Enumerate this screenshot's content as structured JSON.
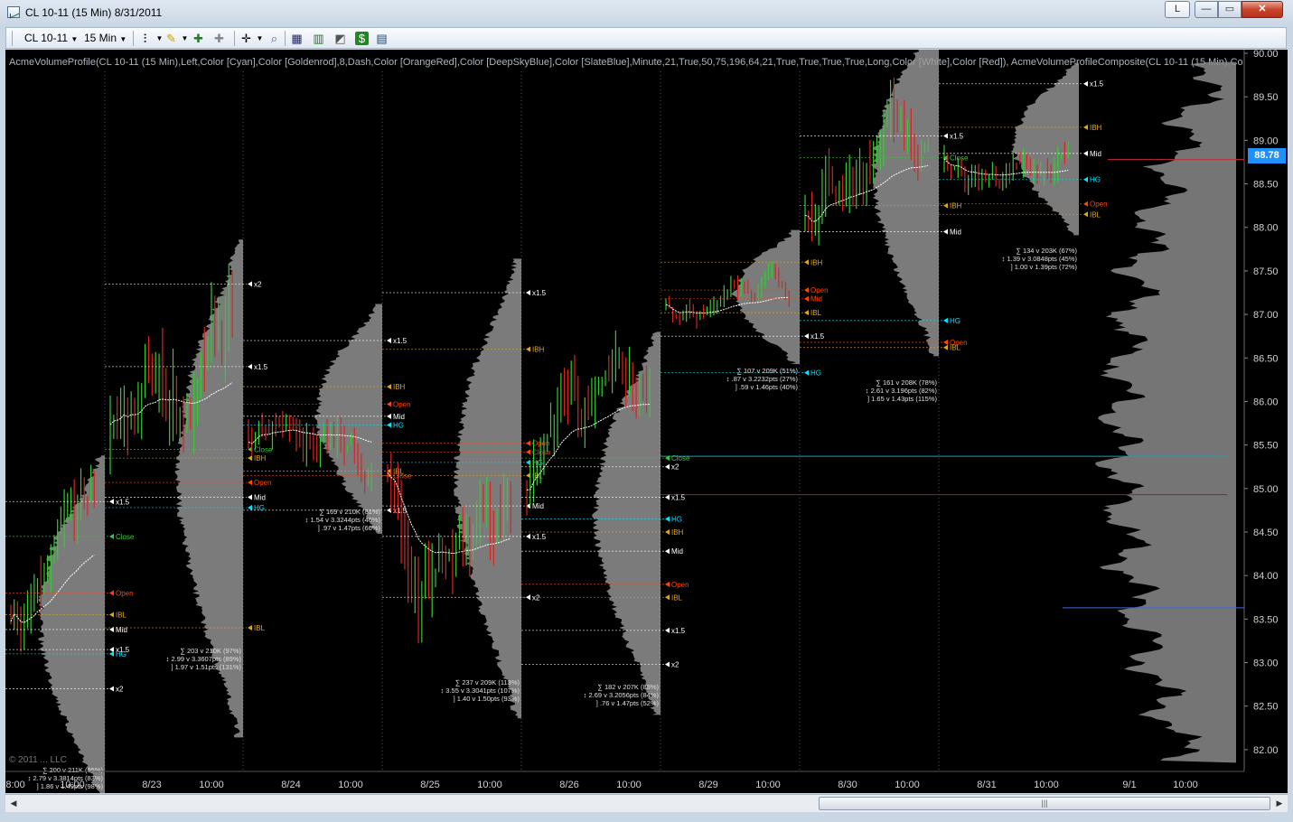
{
  "window": {
    "title": "CL 10-11 (15 Min)  8/31/2011",
    "btn_l": "L",
    "btn_min": "—",
    "btn_max": "▭",
    "btn_close": "✕"
  },
  "toolbar": {
    "instrument": "CL 10-11",
    "interval": "15 Min"
  },
  "indicator_label": "AcmeVolumeProfile(CL 10-11 (15 Min),Left,Color [Cyan],Color [Goldenrod],8,Dash,Color [OrangeRed],Color [DeepSkyBlue],Color [SlateBlue],Minute,21,True,50,75,196,64,21,True,True,True,True,Long,Color [White],Color [Red]), AcmeVolumeProfileComposite(CL 10-11 (15 Min),Co",
  "copyright": "© 2011 ... LLC",
  "current_price": "88.78",
  "colors": {
    "bg": "#000000",
    "up": "#33cc33",
    "down": "#dd2222",
    "cyan": "#00e5ff",
    "gold": "#daa520",
    "orange": "#ff4500",
    "white": "#ffffff"
  },
  "chart_data": {
    "type": "candlestick-volume-profile",
    "y_range": [
      81.75,
      90.0
    ],
    "y_ticks": [
      "90.00",
      "89.50",
      "89.00",
      "88.50",
      "88.00",
      "87.50",
      "87.00",
      "86.50",
      "86.00",
      "85.50",
      "85.00",
      "84.50",
      "84.00",
      "83.50",
      "83.00",
      "82.50",
      "82.00"
    ],
    "x_labels": [
      "08:00",
      "10:00",
      "8/23",
      "10:00",
      "8/24",
      "10:00",
      "8/25",
      "10:00",
      "8/26",
      "10:00",
      "8/29",
      "10:00",
      "8/30",
      "10:00",
      "8/31",
      "10:00",
      "9/1",
      "10:00"
    ],
    "sessions": [
      {
        "stats": [
          "∑ 200 v 211K (95%)",
          "↕ 2.79 v 3.3814pts (83%)",
          "] 1.86 v 1.49pts (98%)"
        ],
        "levels": [
          [
            "x1.5",
            84.85,
            "white"
          ],
          [
            "Close",
            84.45,
            "green"
          ],
          [
            "Open",
            83.8,
            "orange"
          ],
          [
            "IBL",
            83.55,
            "gold"
          ],
          [
            "Mid",
            83.38,
            "white"
          ],
          [
            "x1.5",
            83.15,
            "white"
          ],
          [
            "HG",
            83.1,
            "cyan"
          ],
          [
            "x2",
            82.7,
            "white"
          ]
        ]
      },
      {
        "stats": [
          "∑ 203 v 210K (97%)",
          "↕ 2.99 v 3.3607pts (89%)",
          "] 1.97 v 1.51pts (131%)"
        ],
        "levels": [
          [
            "x2",
            87.35,
            "white"
          ],
          [
            "x1.5",
            86.4,
            "white"
          ],
          [
            "Close",
            85.45,
            "green"
          ],
          [
            "IBH",
            85.35,
            "gold"
          ],
          [
            "Open",
            85.07,
            "orange"
          ],
          [
            "Mid",
            84.9,
            "white"
          ],
          [
            "HG",
            84.78,
            "cyan"
          ],
          [
            "IBL",
            83.4,
            "gold"
          ]
        ]
      },
      {
        "stats": [
          "∑ 169 v 210K (81%)",
          "↕ 1.54 v 3.3244pts (46%)",
          "] .97 v 1.47pts (66%)"
        ],
        "levels": [
          [
            "x1.5",
            86.7,
            "white"
          ],
          [
            "IBH",
            86.17,
            "gold"
          ],
          [
            "Open",
            85.97,
            "orange"
          ],
          [
            "Mid",
            85.83,
            "white"
          ],
          [
            "HG",
            85.73,
            "cyan"
          ],
          [
            "IBL",
            85.2,
            "gold"
          ],
          [
            "Close",
            85.15,
            "orange"
          ],
          [
            "x1.5",
            84.75,
            "white"
          ]
        ]
      },
      {
        "stats": [
          "∑ 237 v 209K (113%)",
          "↕ 3.55 v 3.3041pts (107%)",
          "] 1.40 v 1.50pts (93%)"
        ],
        "levels": [
          [
            "x1.5",
            87.25,
            "white"
          ],
          [
            "IBH",
            86.6,
            "gold"
          ],
          [
            "Open",
            85.52,
            "orange"
          ],
          [
            "Close",
            85.42,
            "orange"
          ],
          [
            "HG",
            85.3,
            "cyan"
          ],
          [
            "IBL",
            85.15,
            "gold"
          ],
          [
            "Mid",
            84.8,
            "white"
          ],
          [
            "x1.5",
            84.45,
            "white"
          ],
          [
            "x2",
            83.75,
            "white"
          ]
        ]
      },
      {
        "stats": [
          "∑ 182 v 207K (88%)",
          "↕ 2.69 v 3.2056pts (84%)",
          "] .76 v 1.47pts (52%)"
        ],
        "levels": [
          [
            "Close",
            85.35,
            "green"
          ],
          [
            "x2",
            85.25,
            "white"
          ],
          [
            "x1.5",
            84.9,
            "white"
          ],
          [
            "HG",
            84.65,
            "cyan"
          ],
          [
            "IBH",
            84.5,
            "gold"
          ],
          [
            "Mid",
            84.28,
            "white"
          ],
          [
            "Open",
            83.9,
            "orange"
          ],
          [
            "IBL",
            83.75,
            "gold"
          ],
          [
            "x1.5",
            83.37,
            "white"
          ],
          [
            "x2",
            82.98,
            "white"
          ]
        ]
      },
      {
        "stats": [
          "∑ 107 v 209K (51%)",
          "↕ .87 v 3.2232pts (27%)",
          "] .59 v 1.46pts (40%)"
        ],
        "levels": [
          [
            "IBH",
            87.6,
            "gold"
          ],
          [
            "Open",
            87.28,
            "orange"
          ],
          [
            "Mid",
            87.18,
            "orange"
          ],
          [
            "IBL",
            87.02,
            "gold"
          ],
          [
            "x1.5",
            86.75,
            "white"
          ],
          [
            "HG",
            86.33,
            "cyan"
          ]
        ]
      },
      {
        "stats": [
          "∑ 161 v 208K (78%)",
          "↕ 2.61 v 3.196pts (82%)",
          "] 1.65 v 1.43pts (115%)"
        ],
        "levels": [
          [
            "x1.5",
            89.05,
            "white"
          ],
          [
            "Close",
            88.8,
            "green"
          ],
          [
            "IBH",
            88.25,
            "gold"
          ],
          [
            "Mid",
            87.95,
            "white"
          ],
          [
            "HG",
            86.93,
            "cyan"
          ],
          [
            "Open",
            86.68,
            "orange"
          ],
          [
            "IBL",
            86.62,
            "gold"
          ]
        ]
      },
      {
        "stats": [
          "∑ 134 v 203K (67%)",
          "↕ 1.39 v 3.0848pts (45%)",
          "] 1.00 v 1.39pts (72%)"
        ],
        "levels": [
          [
            "x1.5",
            89.65,
            "white"
          ],
          [
            "IBH",
            89.15,
            "gold"
          ],
          [
            "Mid",
            88.85,
            "white"
          ],
          [
            "HG",
            88.55,
            "cyan"
          ],
          [
            "Open",
            88.27,
            "orange"
          ],
          [
            "IBL",
            88.15,
            "gold"
          ]
        ]
      }
    ]
  }
}
